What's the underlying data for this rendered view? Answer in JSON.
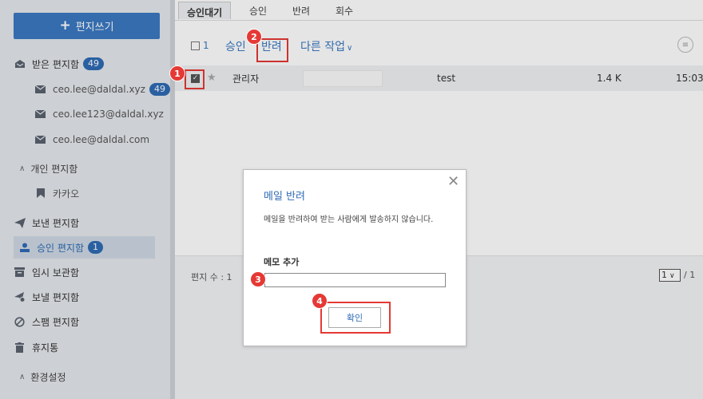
{
  "sidebar": {
    "compose_label": "편지쓰기",
    "inbox": {
      "label": "받은 편지함",
      "count": "49"
    },
    "accounts": [
      {
        "label": "ceo.lee@daldal.xyz",
        "count": "49"
      },
      {
        "label": "ceo.lee123@daldal.xyz"
      },
      {
        "label": "ceo.lee@daldal.com"
      }
    ],
    "personal_section": "개인 편지함",
    "kakao": "카카오",
    "sent": "보낸 편지함",
    "approval": {
      "label": "승인 편지함",
      "count": "1"
    },
    "drafts": "임시 보관함",
    "outbox": "보낼 편지함",
    "spam": "스팸 편지함",
    "trash": "휴지통",
    "settings_section": "환경설정"
  },
  "tabs": [
    "승인대기",
    "승인",
    "반려",
    "회수"
  ],
  "toolbar": {
    "selected_count": "1",
    "approve": "승인",
    "reject": "반려",
    "other": "다른 작업"
  },
  "mail": {
    "from": "관리자",
    "subject": "test",
    "size": "1.4 K",
    "time": "15:03"
  },
  "footer": {
    "count_label": "편지 수 : 1",
    "page": "1",
    "total": "/ 1"
  },
  "dialog": {
    "title": "메일 반려",
    "description": "메일을 반려하여 받는 사람에게 발송하지 않습니다.",
    "memo_label": "메모 추가",
    "memo_value": "",
    "confirm": "확인"
  },
  "markers": [
    "1",
    "2",
    "3",
    "4"
  ],
  "colors": {
    "accent": "#3a79c2",
    "highlight": "#e53935"
  }
}
